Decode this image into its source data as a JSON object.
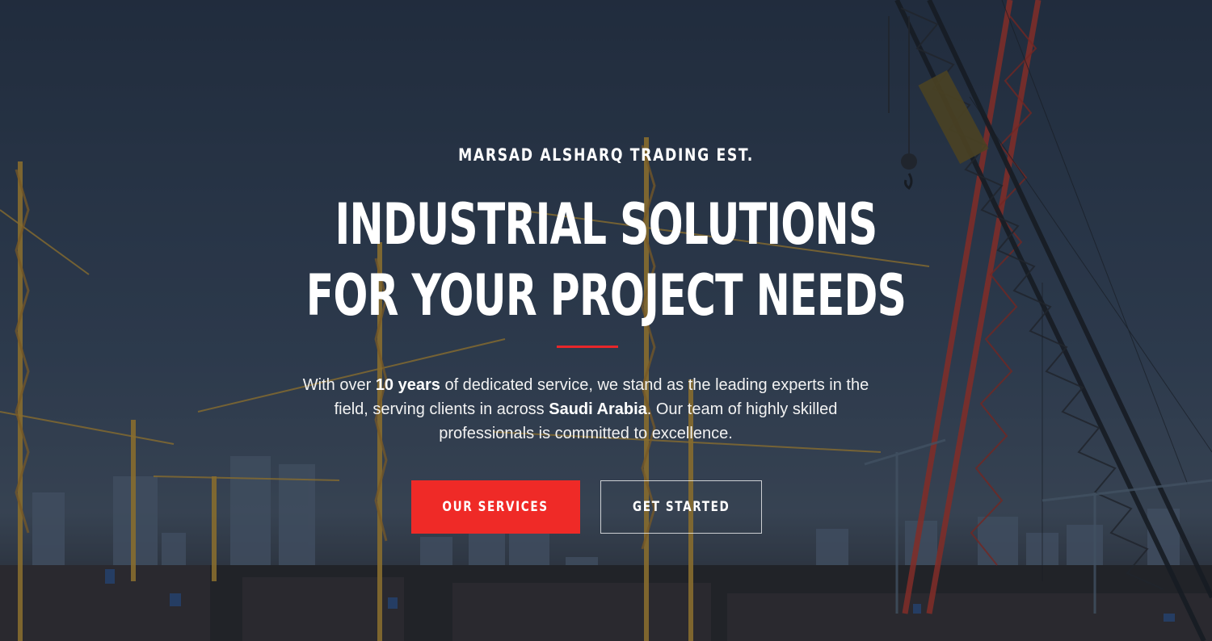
{
  "hero": {
    "eyebrow": "MARSAD ALSHARQ TRADING EST.",
    "headline_line1": "INDUSTRIAL SOLUTIONS",
    "headline_line2": "FOR YOUR PROJECT NEEDS",
    "lead": {
      "part1": "With over ",
      "highlight1": "10 years",
      "part2": " of dedicated service, we stand as the leading experts in the field, serving clients in across ",
      "highlight2": "Saudi Arabia",
      "part3": ". Our team of highly skilled professionals is committed to excellence."
    },
    "primary_button": "OUR SERVICES",
    "secondary_button": "GET STARTED"
  },
  "colors": {
    "accent": "#ef2a27",
    "divider": "#e8262a",
    "sky": "#2e3b4f"
  },
  "background_image": "construction-cranes-city-skyline"
}
